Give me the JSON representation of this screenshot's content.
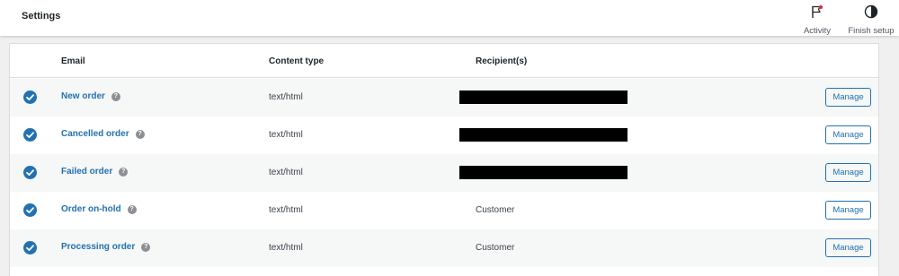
{
  "topbar": {
    "title": "Settings",
    "activity_label": "Activity",
    "finish_setup_label": "Finish setup"
  },
  "table": {
    "headers": {
      "email": "Email",
      "content_type": "Content type",
      "recipients": "Recipient(s)"
    },
    "rows": [
      {
        "email": "New order",
        "content_type": "text/html",
        "recipient": "",
        "recipient_redacted": true,
        "manage": "Manage"
      },
      {
        "email": "Cancelled order",
        "content_type": "text/html",
        "recipient": "",
        "recipient_redacted": true,
        "manage": "Manage"
      },
      {
        "email": "Failed order",
        "content_type": "text/html",
        "recipient": "",
        "recipient_redacted": true,
        "manage": "Manage"
      },
      {
        "email": "Order on-hold",
        "content_type": "text/html",
        "recipient": "Customer",
        "recipient_redacted": false,
        "manage": "Manage"
      },
      {
        "email": "Processing order",
        "content_type": "text/html",
        "recipient": "Customer",
        "recipient_redacted": false,
        "manage": "Manage"
      }
    ],
    "help_glyph": "?"
  },
  "colors": {
    "accent": "#2271b1",
    "status_enabled": "#2271b1"
  },
  "icons": {
    "activity": "flag-icon",
    "finish_setup": "half-circle-icon",
    "enabled": "check-circle-icon",
    "help": "help-icon"
  }
}
